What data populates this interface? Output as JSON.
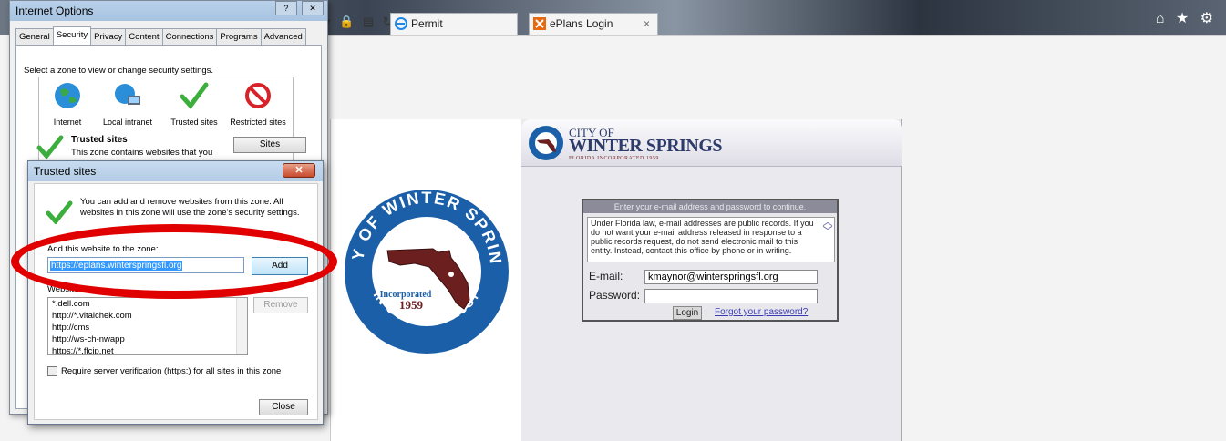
{
  "browser": {
    "tabs": [
      {
        "label": "Permit"
      },
      {
        "label": "ePlans Login"
      }
    ],
    "tab_close": "×",
    "nav_icons": [
      "dropdown-icon",
      "lock-icon",
      "document-icon",
      "refresh-icon"
    ],
    "right_icons": "⌂ ★ ⚙"
  },
  "internet_options": {
    "title": "Internet Options",
    "window_buttons": [
      "?",
      "✕"
    ],
    "tabs": [
      "General",
      "Security",
      "Privacy",
      "Content",
      "Connections",
      "Programs",
      "Advanced"
    ],
    "active_tab": "Security",
    "zone_label": "Select a zone to view or change security settings.",
    "zones": [
      "Internet",
      "Local intranet",
      "Trusted sites",
      "Restricted sites"
    ],
    "selected_zone_title": "Trusted sites",
    "selected_zone_desc": "This zone contains websites that you trust not to damage your computer or",
    "sites_button": "Sites"
  },
  "trusted_sites": {
    "title": "Trusted sites",
    "close_glyph": "✕",
    "message": "You can add and remove websites from this zone. All websites in this zone will use the zone's security settings.",
    "add_label": "Add this website to the zone:",
    "add_value": "https://eplans.winterspringsfl.org",
    "add_button": "Add",
    "websites_label": "Websites:",
    "websites": [
      "*.dell.com",
      "http://*.vitalchek.com",
      "http://cms",
      "http://ws-ch-nwapp",
      "https://*.flcip.net"
    ],
    "remove_button": "Remove",
    "require_label": "Require server verification (https:) for all sites in this zone",
    "close_button": "Close"
  },
  "page": {
    "seal": {
      "top_text": "CITY OF WINTER SPRINGS",
      "bottom_text": "IN GOD WE TRUST",
      "incorporated": "Incorporated",
      "year": "1959"
    },
    "banner": {
      "line1": "CITY OF",
      "line2": "WINTER SPRINGS",
      "line3": "FLORIDA INCORPORATED 1959"
    },
    "login": {
      "header": "Enter your e-mail address and password to continue.",
      "notice": "Under Florida law, e-mail addresses are public records. If you do not want your e-mail address released in response to a public records request, do not send electronic mail to this entity. Instead, contact this office by phone or in writing.",
      "email_label": "E-mail:",
      "email_value": "kmaynor@winterspringsfl.org",
      "password_label": "Password:",
      "password_value": "",
      "login_button": "Login",
      "forgot_link": "Forgot your password?"
    }
  },
  "colors": {
    "annotation": "#e00000",
    "link": "#3b3bb5",
    "seal_blue": "#1a5fa8",
    "florida_maroon": "#6b1f1f"
  }
}
